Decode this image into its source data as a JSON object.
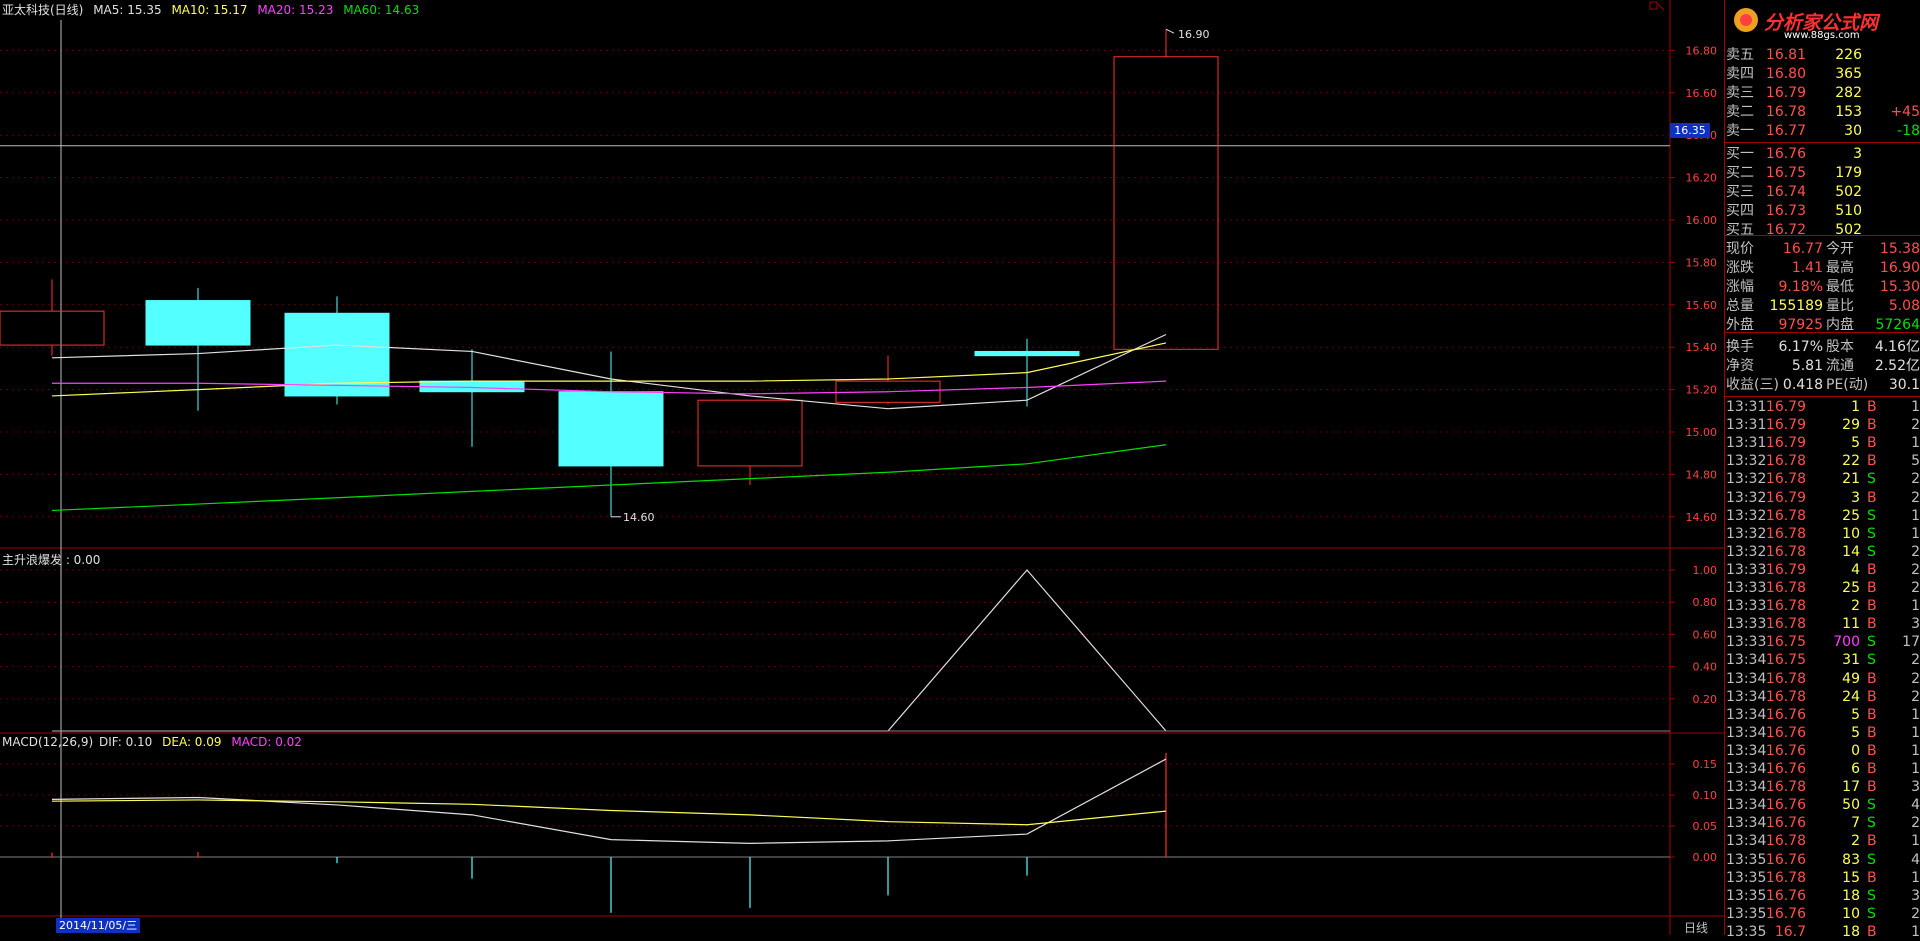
{
  "header": {
    "stock_name": "亚太科技(日线)",
    "ma5": "MA5: 15.35",
    "ma10": "MA10: 15.17",
    "ma20": "MA20: 15.23",
    "ma60": "MA60: 14.63",
    "indicator_label": "主升浪爆发 : 0.00",
    "macd_label": "MACD(12,26,9)",
    "dif": "DIF: 0.10",
    "dea": "DEA: 0.09",
    "macd": "MACD: 0.02"
  },
  "colors": {
    "up": "#ff3030",
    "down": "#54ffff",
    "ma5": "#e0e0e0",
    "ma10": "#ffff54",
    "ma20": "#ff40ff",
    "ma60": "#00e000",
    "grid": "#a00000"
  },
  "crosshair_price": "16.35",
  "date_label": "2014/11/05/三",
  "period_label": "日线",
  "logo_text": "分析家公式网",
  "logo_url": "www.88gs.com",
  "chart_data": [
    {
      "type": "candlestick",
      "title": "亚太科技(日线)",
      "ylim": [
        14.5,
        17.0
      ],
      "y_ticks": [
        "16.80",
        "16.60",
        "16.40",
        "16.20",
        "16.00",
        "15.80",
        "15.60",
        "15.40",
        "15.20",
        "15.00",
        "14.80",
        "14.60"
      ],
      "candles": [
        {
          "open": 15.57,
          "close": 15.41,
          "high": 15.72,
          "low": 15.36,
          "dir": "up_hollow"
        },
        {
          "open": 15.62,
          "close": 15.41,
          "high": 15.68,
          "low": 15.1,
          "dir": "down"
        },
        {
          "open": 15.56,
          "close": 15.17,
          "high": 15.64,
          "low": 15.13,
          "dir": "down"
        },
        {
          "open": 15.24,
          "close": 15.19,
          "high": 15.39,
          "low": 14.93,
          "dir": "down"
        },
        {
          "open": 15.19,
          "close": 14.84,
          "high": 15.38,
          "low": 14.6,
          "dir": "down"
        },
        {
          "open": 15.15,
          "close": 14.84,
          "high": 15.15,
          "low": 14.75,
          "dir": "up_hollow"
        },
        {
          "open": 15.14,
          "close": 15.24,
          "high": 15.36,
          "low": 15.13,
          "dir": "up_hollow"
        },
        {
          "open": 15.38,
          "close": 15.36,
          "high": 15.44,
          "low": 15.12,
          "dir": "down"
        },
        {
          "open": 15.39,
          "close": 16.77,
          "high": 16.9,
          "low": 15.39,
          "dir": "up_hollow"
        }
      ],
      "annotations": {
        "high": "16.90",
        "low": "14.60"
      },
      "ma_series": [
        {
          "name": "MA5",
          "values": [
            15.35,
            15.37,
            15.41,
            15.38,
            15.25,
            15.17,
            15.11,
            15.15,
            15.46
          ]
        },
        {
          "name": "MA10",
          "values": [
            15.17,
            15.2,
            15.23,
            15.24,
            15.24,
            15.24,
            15.25,
            15.28,
            15.42
          ]
        },
        {
          "name": "MA20",
          "values": [
            15.23,
            15.23,
            15.22,
            15.21,
            15.19,
            15.18,
            15.19,
            15.21,
            15.24
          ]
        },
        {
          "name": "MA60",
          "values": [
            14.63,
            14.66,
            14.69,
            14.72,
            14.75,
            14.78,
            14.81,
            14.85,
            14.94
          ]
        }
      ]
    },
    {
      "type": "line",
      "title": "主升浪爆发 : 0.00",
      "ylim": [
        0,
        1.05
      ],
      "y_ticks": [
        "1.00",
        "0.80",
        "0.60",
        "0.40",
        "0.20"
      ],
      "values": [
        0,
        0,
        0,
        0,
        0,
        0,
        0,
        1.0,
        0
      ]
    },
    {
      "type": "bar",
      "title": "MACD(12,26,9)",
      "ylim": [
        -0.035,
        0.17
      ],
      "y_ticks": [
        "0.15",
        "0.10",
        "0.05",
        "0.00"
      ],
      "series": [
        {
          "name": "DIF",
          "values": [
            0.093,
            0.096,
            0.084,
            0.068,
            0.028,
            0.022,
            0.026,
            0.037,
            0.158
          ]
        },
        {
          "name": "DEA",
          "values": [
            0.09,
            0.092,
            0.089,
            0.085,
            0.075,
            0.068,
            0.057,
            0.052,
            0.074
          ]
        },
        {
          "name": "MACD",
          "values": [
            0.007,
            0.008,
            -0.01,
            -0.035,
            -0.09,
            -0.082,
            -0.062,
            -0.03,
            0.168
          ]
        }
      ]
    }
  ],
  "order_book": {
    "asks": [
      {
        "label": "卖五",
        "price": "16.81",
        "vol": "226",
        "chg": ""
      },
      {
        "label": "卖四",
        "price": "16.80",
        "vol": "365",
        "chg": ""
      },
      {
        "label": "卖三",
        "price": "16.79",
        "vol": "282",
        "chg": ""
      },
      {
        "label": "卖二",
        "price": "16.78",
        "vol": "153",
        "chg": "+45"
      },
      {
        "label": "卖一",
        "price": "16.77",
        "vol": "30",
        "chg": "-18"
      }
    ],
    "bids": [
      {
        "label": "买一",
        "price": "16.76",
        "vol": "3"
      },
      {
        "label": "买二",
        "price": "16.75",
        "vol": "179"
      },
      {
        "label": "买三",
        "price": "16.74",
        "vol": "502"
      },
      {
        "label": "买四",
        "price": "16.73",
        "vol": "510"
      },
      {
        "label": "买五",
        "price": "16.72",
        "vol": "502"
      }
    ]
  },
  "quote": [
    {
      "l1": "现价",
      "v1": "16.77",
      "l2": "今开",
      "v2": "15.38",
      "c1": "red",
      "c2": "red"
    },
    {
      "l1": "涨跌",
      "v1": "1.41",
      "l2": "最高",
      "v2": "16.90",
      "c1": "red",
      "c2": "red"
    },
    {
      "l1": "涨幅",
      "v1": "9.18%",
      "l2": "最低",
      "v2": "15.30",
      "c1": "red",
      "c2": "red"
    },
    {
      "l1": "总量",
      "v1": "155189",
      "l2": "量比",
      "v2": "5.08",
      "c1": "yellow",
      "c2": "red"
    },
    {
      "l1": "外盘",
      "v1": "97925",
      "l2": "内盘",
      "v2": "57264",
      "c1": "red",
      "c2": "green"
    },
    {
      "l1": "换手",
      "v1": "6.17%",
      "l2": "股本",
      "v2": "4.16亿",
      "c1": "white",
      "c2": "white"
    },
    {
      "l1": "净资",
      "v1": "5.81",
      "l2": "流通",
      "v2": "2.52亿",
      "c1": "white",
      "c2": "white"
    },
    {
      "l1": "收益(三)",
      "v1": "0.418",
      "l2": "PE(动)",
      "v2": "30.1",
      "c1": "white",
      "c2": "white"
    }
  ],
  "ticks": [
    {
      "time": "13:31",
      "price": "16.79",
      "vol": "1",
      "side": "B",
      "n": "1",
      "vc": "yellow"
    },
    {
      "time": "13:31",
      "price": "16.79",
      "vol": "29",
      "side": "B",
      "n": "2",
      "vc": "yellow"
    },
    {
      "time": "13:31",
      "price": "16.79",
      "vol": "5",
      "side": "B",
      "n": "1",
      "vc": "yellow"
    },
    {
      "time": "13:32",
      "price": "16.78",
      "vol": "22",
      "side": "B",
      "n": "5",
      "vc": "yellow"
    },
    {
      "time": "13:32",
      "price": "16.78",
      "vol": "21",
      "side": "S",
      "n": "2",
      "vc": "yellow"
    },
    {
      "time": "13:32",
      "price": "16.79",
      "vol": "3",
      "side": "B",
      "n": "2",
      "vc": "yellow"
    },
    {
      "time": "13:32",
      "price": "16.78",
      "vol": "25",
      "side": "S",
      "n": "1",
      "vc": "yellow"
    },
    {
      "time": "13:32",
      "price": "16.78",
      "vol": "10",
      "side": "S",
      "n": "1",
      "vc": "yellow"
    },
    {
      "time": "13:32",
      "price": "16.78",
      "vol": "14",
      "side": "S",
      "n": "2",
      "vc": "yellow"
    },
    {
      "time": "13:33",
      "price": "16.79",
      "vol": "4",
      "side": "B",
      "n": "2",
      "vc": "yellow"
    },
    {
      "time": "13:33",
      "price": "16.78",
      "vol": "25",
      "side": "B",
      "n": "2",
      "vc": "yellow"
    },
    {
      "time": "13:33",
      "price": "16.78",
      "vol": "2",
      "side": "B",
      "n": "1",
      "vc": "yellow"
    },
    {
      "time": "13:33",
      "price": "16.78",
      "vol": "11",
      "side": "B",
      "n": "3",
      "vc": "yellow"
    },
    {
      "time": "13:33",
      "price": "16.75",
      "vol": "700",
      "side": "S",
      "n": "17",
      "vc": "magenta"
    },
    {
      "time": "13:34",
      "price": "16.75",
      "vol": "31",
      "side": "S",
      "n": "2",
      "vc": "yellow"
    },
    {
      "time": "13:34",
      "price": "16.78",
      "vol": "49",
      "side": "B",
      "n": "2",
      "vc": "yellow"
    },
    {
      "time": "13:34",
      "price": "16.78",
      "vol": "24",
      "side": "B",
      "n": "2",
      "vc": "yellow"
    },
    {
      "time": "13:34",
      "price": "16.76",
      "vol": "5",
      "side": "B",
      "n": "1",
      "vc": "yellow"
    },
    {
      "time": "13:34",
      "price": "16.76",
      "vol": "5",
      "side": "B",
      "n": "1",
      "vc": "yellow"
    },
    {
      "time": "13:34",
      "price": "16.76",
      "vol": "0",
      "side": "B",
      "n": "1",
      "vc": "yellow"
    },
    {
      "time": "13:34",
      "price": "16.76",
      "vol": "6",
      "side": "B",
      "n": "1",
      "vc": "yellow"
    },
    {
      "time": "13:34",
      "price": "16.78",
      "vol": "17",
      "side": "B",
      "n": "3",
      "vc": "yellow"
    },
    {
      "time": "13:34",
      "price": "16.76",
      "vol": "50",
      "side": "S",
      "n": "4",
      "vc": "yellow"
    },
    {
      "time": "13:34",
      "price": "16.76",
      "vol": "7",
      "side": "S",
      "n": "2",
      "vc": "yellow"
    },
    {
      "time": "13:34",
      "price": "16.78",
      "vol": "2",
      "side": "B",
      "n": "1",
      "vc": "yellow"
    },
    {
      "time": "13:35",
      "price": "16.76",
      "vol": "83",
      "side": "S",
      "n": "4",
      "vc": "yellow"
    },
    {
      "time": "13:35",
      "price": "16.78",
      "vol": "15",
      "side": "B",
      "n": "1",
      "vc": "yellow"
    },
    {
      "time": "13:35",
      "price": "16.76",
      "vol": "18",
      "side": "S",
      "n": "3",
      "vc": "yellow"
    },
    {
      "time": "13:35",
      "price": "16.76",
      "vol": "10",
      "side": "S",
      "n": "2",
      "vc": "yellow"
    },
    {
      "time": "13:35",
      "price": "16.7",
      "vol": "18",
      "side": "B",
      "n": "1",
      "vc": "yellow"
    }
  ]
}
